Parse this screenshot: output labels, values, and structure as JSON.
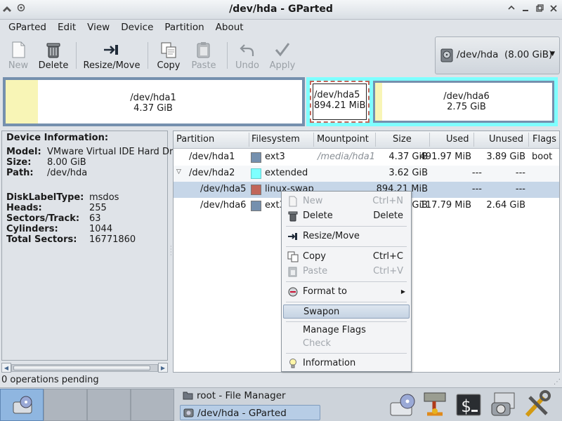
{
  "window": {
    "title": "/dev/hda - GParted",
    "title_icon": "app-menu-icon",
    "controls": [
      "up-icon",
      "minimize-icon",
      "maximize-icon",
      "close-icon"
    ]
  },
  "menubar": [
    "GParted",
    "Edit",
    "View",
    "Device",
    "Partition",
    "About"
  ],
  "toolbar": {
    "new": "New",
    "delete": "Delete",
    "resize_move": "Resize/Move",
    "copy": "Copy",
    "paste": "Paste",
    "undo": "Undo",
    "apply": "Apply"
  },
  "device_combo": "/dev/hda  (8.00 GiB)",
  "diskmap": {
    "hda1": {
      "name": "/dev/hda1",
      "size": "4.37 GiB",
      "used_fraction": 0.11
    },
    "hda5": {
      "name": "/dev/hda5",
      "size": "894.21 MiB"
    },
    "hda6": {
      "name": "/dev/hda6",
      "size": "2.75 GiB",
      "used_fraction": 0.04
    },
    "colors": {
      "ext3": "#7590ae",
      "extended": "#7effff",
      "linux_swap": "#c1665a",
      "unused": "#f8f5b6"
    }
  },
  "device_info": {
    "heading": "Device Information:",
    "rows": [
      {
        "k": "Model:",
        "v": "VMware Virtual IDE Hard Dr"
      },
      {
        "k": "Size:",
        "v": "8.00 GiB"
      },
      {
        "k": "Path:",
        "v": "/dev/hda"
      },
      {
        "k": "DiskLabelType:",
        "v": "msdos"
      },
      {
        "k": "Heads:",
        "v": "255"
      },
      {
        "k": "Sectors/Track:",
        "v": "63"
      },
      {
        "k": "Cylinders:",
        "v": "1044"
      },
      {
        "k": "Total Sectors:",
        "v": "16771860"
      }
    ]
  },
  "table": {
    "headers": [
      "Partition",
      "Filesystem",
      "Mountpoint",
      "Size",
      "Used",
      "Unused",
      "Flags"
    ],
    "rows": [
      {
        "partition": "/dev/hda1",
        "fs": "ext3",
        "fs_color": "#7590ae",
        "mount": "/media/hda1",
        "size": "4.37 GiB",
        "used": "491.97 MiB",
        "unused": "3.89 GiB",
        "flags": "boot"
      },
      {
        "partition": "/dev/hda2",
        "fs": "extended",
        "fs_color": "#7effff",
        "mount": "",
        "size": "3.62 GiB",
        "used": "---",
        "unused": "---",
        "flags": ""
      },
      {
        "partition": "/dev/hda5",
        "fs": "linux-swap",
        "fs_color": "#c1665a",
        "mount": "",
        "size": "894.21 MiB",
        "used": "---",
        "unused": "---",
        "flags": ""
      },
      {
        "partition": "/dev/hda6",
        "fs": "ext3",
        "fs_color": "#7590ae",
        "mount": "",
        "size": "2.75 GiB",
        "used": "117.79 MiB",
        "unused": "2.64 GiB",
        "flags": ""
      }
    ]
  },
  "context_menu": {
    "new": {
      "label": "New",
      "accel": "Ctrl+N"
    },
    "delete": {
      "label": "Delete",
      "accel": "Delete"
    },
    "resize": {
      "label": "Resize/Move"
    },
    "copy": {
      "label": "Copy",
      "accel": "Ctrl+C"
    },
    "paste": {
      "label": "Paste",
      "accel": "Ctrl+V"
    },
    "format": {
      "label": "Format to"
    },
    "swapon": {
      "label": "Swapon"
    },
    "flags": {
      "label": "Manage Flags"
    },
    "check": {
      "label": "Check"
    },
    "info": {
      "label": "Information"
    }
  },
  "status": "0 operations pending",
  "taskbar": {
    "tasks": [
      "root - File Manager",
      "/dev/hda - GParted"
    ],
    "tray_icons": [
      "disk-utility-icon",
      "network-icon",
      "terminal-icon",
      "camera-icon",
      "tools-icon"
    ]
  }
}
